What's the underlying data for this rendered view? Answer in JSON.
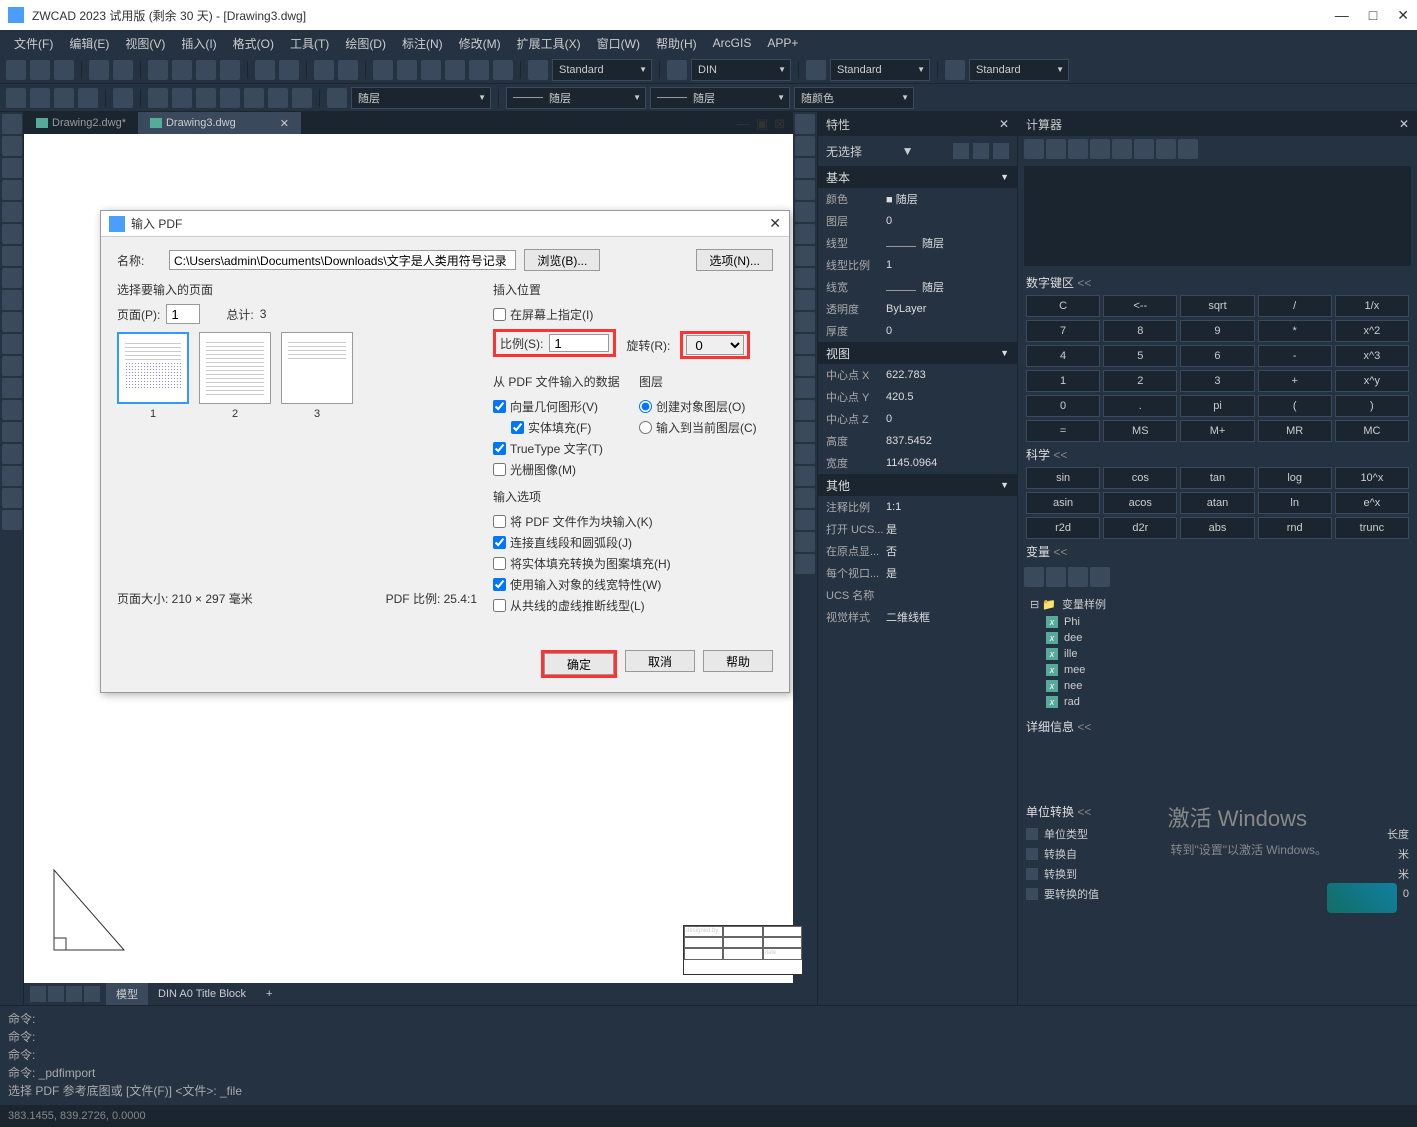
{
  "titlebar": {
    "title": "ZWCAD 2023 试用版 (剩余 30 天) - [Drawing3.dwg]"
  },
  "menubar": [
    "文件(F)",
    "编辑(E)",
    "视图(V)",
    "插入(I)",
    "格式(O)",
    "工具(T)",
    "绘图(D)",
    "标注(N)",
    "修改(M)",
    "扩展工具(X)",
    "窗口(W)",
    "帮助(H)",
    "ArcGIS",
    "APP+"
  ],
  "toolbar2": {
    "layer": "随层",
    "layer2": "随层",
    "layer3": "随层",
    "color": "随颜色",
    "std1": "Standard",
    "din": "DIN",
    "std2": "Standard",
    "std3": "Standard"
  },
  "tabs": {
    "t1": "Drawing2.dwg*",
    "t2": "Drawing3.dwg"
  },
  "bottom_tabs": {
    "model": "模型",
    "layout": "DIN A0 Title Block",
    "plus": "+"
  },
  "title_block": {
    "designed_by": "designed by",
    "date": "date"
  },
  "command": {
    "prompt": "命令:",
    "line1": "命令:",
    "line2": "命令:",
    "line3": "命令:",
    "line4": "命令: _pdfimport",
    "line5": "选择 PDF 参考底图或 [文件(F)] <文件>: _file"
  },
  "statusbar": {
    "coords": "383.1455, 839.2726, 0.0000"
  },
  "properties": {
    "title": "特性",
    "noselect": "无选择",
    "sections": {
      "basic": "基本",
      "view": "视图",
      "other": "其他"
    },
    "rows": {
      "color": {
        "label": "颜色",
        "value": "随层"
      },
      "layer": {
        "label": "图层",
        "value": "0"
      },
      "linetype": {
        "label": "线型",
        "value": "随层"
      },
      "ltscale": {
        "label": "线型比例",
        "value": "1"
      },
      "lineweight": {
        "label": "线宽",
        "value": "随层"
      },
      "transparency": {
        "label": "透明度",
        "value": "ByLayer"
      },
      "thickness": {
        "label": "厚度",
        "value": "0"
      },
      "centerx": {
        "label": "中心点 X",
        "value": "622.783"
      },
      "centery": {
        "label": "中心点 Y",
        "value": "420.5"
      },
      "centerz": {
        "label": "中心点 Z",
        "value": "0"
      },
      "height": {
        "label": "高度",
        "value": "837.5452"
      },
      "width": {
        "label": "宽度",
        "value": "1145.0964"
      },
      "annoscale": {
        "label": "注释比例",
        "value": "1:1"
      },
      "ucs_open": {
        "label": "打开 UCS...",
        "value": "是"
      },
      "origin": {
        "label": "在原点显...",
        "value": "否"
      },
      "perview": {
        "label": "每个视口...",
        "value": "是"
      },
      "ucsname": {
        "label": "UCS 名称",
        "value": ""
      },
      "visualstyle": {
        "label": "视觉样式",
        "value": "二维线框"
      }
    }
  },
  "calculator": {
    "title": "计算器",
    "numpad_title": "数字键区",
    "sci_title": "科学",
    "var_title": "变量",
    "detail_title": "详细信息",
    "unit_title": "单位转换",
    "numpad": [
      "C",
      "<--",
      "sqrt",
      "/",
      "1/x",
      "7",
      "8",
      "9",
      "*",
      "x^2",
      "4",
      "5",
      "6",
      "-",
      "x^3",
      "1",
      "2",
      "3",
      "+",
      "x^y",
      "0",
      ".",
      "pi",
      "(",
      ")",
      "=",
      "MS",
      "M+",
      "MR",
      "MC"
    ],
    "sci": [
      "sin",
      "cos",
      "tan",
      "log",
      "10^x",
      "asin",
      "acos",
      "atan",
      "ln",
      "e^x",
      "r2d",
      "d2r",
      "abs",
      "rnd",
      "trunc"
    ],
    "vars": {
      "root": "变量样例",
      "items": [
        "Phi",
        "dee",
        "ille",
        "mee",
        "nee",
        "rad"
      ]
    },
    "units": {
      "type": {
        "label": "单位类型",
        "value": "长度"
      },
      "from": {
        "label": "转换自",
        "value": "米"
      },
      "to": {
        "label": "转换到",
        "value": "米"
      },
      "val": {
        "label": "要转换的值",
        "value": "0"
      }
    }
  },
  "pdf_dialog": {
    "title": "输入 PDF",
    "name_label": "名称:",
    "name_value": "C:\\Users\\admin\\Documents\\Downloads\\文字是人类用符号记录",
    "browse": "浏览(B)...",
    "options": "选项(N)...",
    "select_pages": "选择要输入的页面",
    "page_label": "页面(P):",
    "page_value": "1",
    "total_label": "总计:",
    "total_value": "3",
    "thumbs": [
      "1",
      "2",
      "3"
    ],
    "pagesize": "页面大小: 210 × 297 毫米",
    "pdfscale": "PDF 比例: 25.4:1",
    "insert_pos": "插入位置",
    "screen_specify": "在屏幕上指定(I)",
    "scale_label": "比例(S):",
    "scale_value": "1",
    "rotate_label": "旋转(R):",
    "rotate_value": "0",
    "from_pdf": "从 PDF 文件输入的数据",
    "vector_geom": "向量几何图形(V)",
    "solid_fill": "实体填充(F)",
    "truetype": "TrueType 文字(T)",
    "raster": "光栅图像(M)",
    "layers": "图层",
    "create_obj_layer": "创建对象图层(O)",
    "input_current": "输入到当前图层(C)",
    "import_opts": "输入选项",
    "as_block": "将 PDF 文件作为块输入(K)",
    "join_lines": "连接直线段和圆弧段(J)",
    "solid_to_hatch": "将实体填充转换为图案填充(H)",
    "use_lineweight": "使用输入对象的线宽特性(W)",
    "infer_linetype": "从共线的虚线推断线型(L)",
    "ok": "确定",
    "cancel": "取消",
    "help": "帮助"
  },
  "watermark": {
    "main": "激活 Windows",
    "sub": "转到\"设置\"以激活 Windows。"
  }
}
